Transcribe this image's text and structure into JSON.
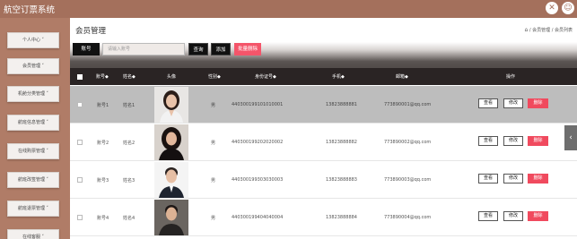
{
  "app": {
    "title": "航空订票系统"
  },
  "header_icons": [
    "tools-icon",
    "user-icon"
  ],
  "sidebar": {
    "items": [
      {
        "label": "个人中心 ˅"
      },
      {
        "label": "会员管理 ˅"
      },
      {
        "label": "机舱分类管理 ˅"
      },
      {
        "label": "航班信息管理 ˅"
      },
      {
        "label": "在线购票管理 ˅"
      },
      {
        "label": "航班改签管理 ˅"
      },
      {
        "label": "航班退票管理 ˅"
      },
      {
        "label": "在线客服 ˅"
      }
    ]
  },
  "main": {
    "title": "会员管理",
    "breadcrumb": {
      "home_icon": "⌂",
      "path": "/ 会员管理 / 会员列表"
    }
  },
  "toolbar": {
    "search_label": "账号",
    "search_placeholder": "请输入账号",
    "query_label": "查询",
    "add_label": "添加",
    "batch_delete_label": "批量删除"
  },
  "table": {
    "columns": [
      "账号◆",
      "姓名◆",
      "头像",
      "性别◆",
      "身份证号◆",
      "手机◆",
      "邮箱◆",
      "操作"
    ],
    "rows": [
      {
        "account": "账号1",
        "name": "姓名1",
        "gender": "男",
        "id_card": "440300199101010001",
        "phone": "13823888881",
        "email": "773890001@qq.com",
        "selected": true
      },
      {
        "account": "账号2",
        "name": "姓名2",
        "gender": "男",
        "id_card": "440300199202020002",
        "phone": "13823888882",
        "email": "773890002@qq.com",
        "selected": false
      },
      {
        "account": "账号3",
        "name": "姓名3",
        "gender": "男",
        "id_card": "440300199303030003",
        "phone": "13823888883",
        "email": "773890003@qq.com",
        "selected": false
      },
      {
        "account": "账号4",
        "name": "姓名4",
        "gender": "男",
        "id_card": "440300199404040004",
        "phone": "13823888884",
        "email": "773890004@qq.com",
        "selected": false
      }
    ],
    "actions": {
      "view": "查看",
      "edit": "修改",
      "delete": "删除"
    }
  },
  "side_arrow": "‹"
}
